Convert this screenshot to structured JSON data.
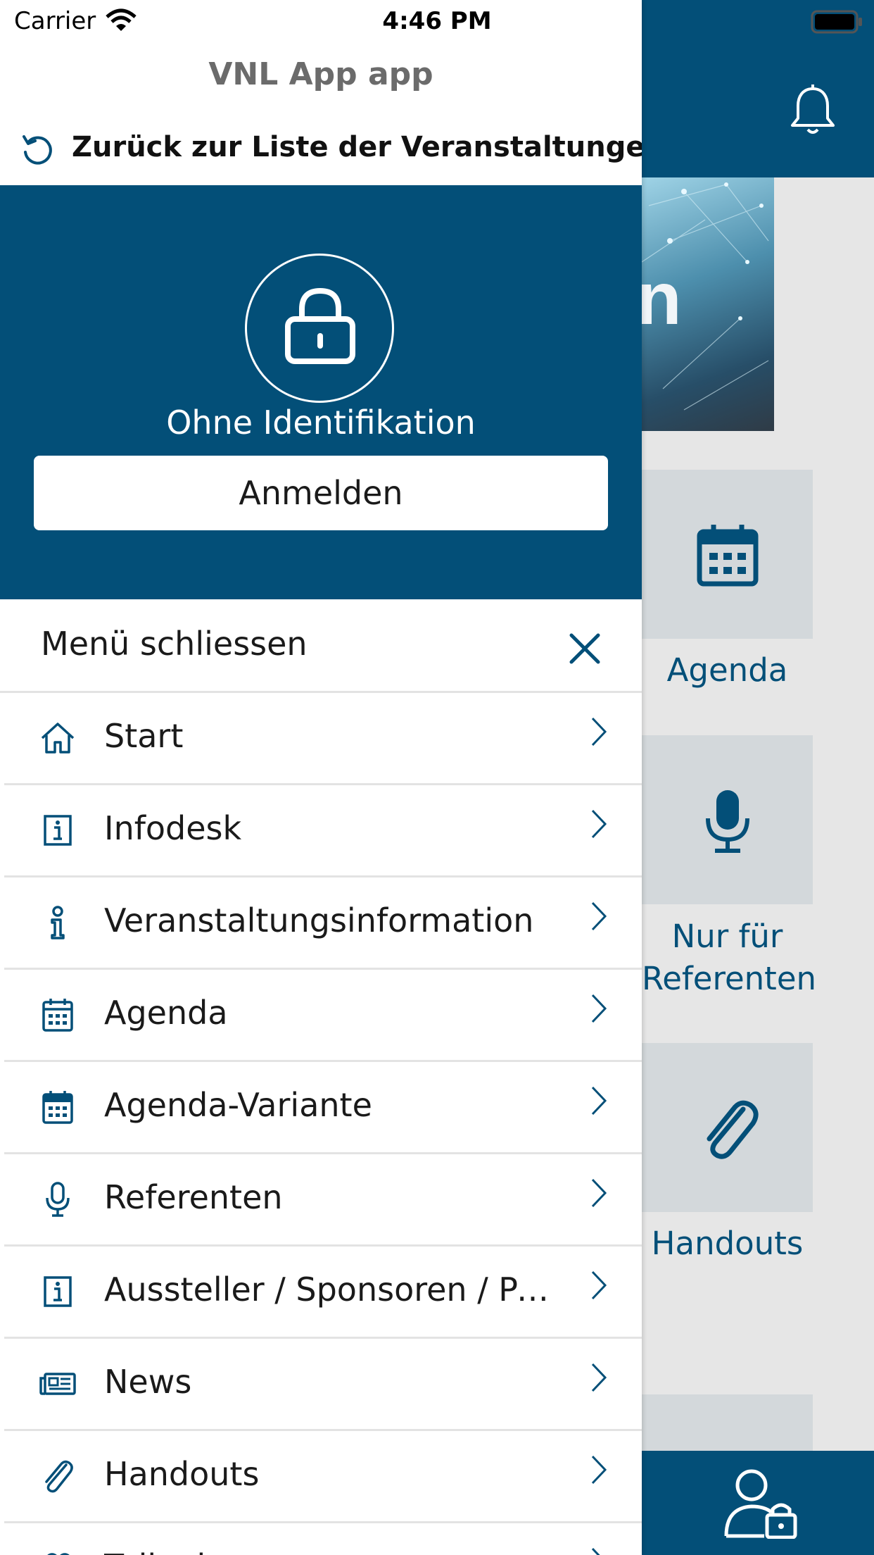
{
  "status_bar": {
    "carrier": "Carrier",
    "time": "4:46 PM"
  },
  "drawer": {
    "app_title": "VNL App app",
    "back_label": "Zurück zur Liste der Veranstaltungen",
    "profile": {
      "status": "Ohne Identifikation",
      "login_label": "Anmelden"
    },
    "close_label": "Menü schliessen",
    "menu": [
      {
        "label": "Start",
        "icon": "home-icon"
      },
      {
        "label": "Infodesk",
        "icon": "info-box-icon"
      },
      {
        "label": "Veranstaltungsinformation",
        "icon": "info-icon"
      },
      {
        "label": "Agenda",
        "icon": "calendar-outline-icon"
      },
      {
        "label": "Agenda-Variante",
        "icon": "calendar-filled-icon"
      },
      {
        "label": "Referenten",
        "icon": "microphone-icon"
      },
      {
        "label": "Aussteller / Sponsoren / Pa...",
        "icon": "info-box-icon"
      },
      {
        "label": "News",
        "icon": "newspaper-icon"
      },
      {
        "label": "Handouts",
        "icon": "paperclip-icon"
      },
      {
        "label": "Teilneh",
        "icon": "people-icon"
      }
    ]
  },
  "background": {
    "tiles": [
      {
        "label": "Agenda",
        "icon": "calendar-icon"
      },
      {
        "label_lines": [
          "Nur für",
          "Referenten"
        ],
        "icon": "microphone-icon"
      },
      {
        "label": "Handouts",
        "icon": "paperclip-icon"
      }
    ]
  },
  "colors": {
    "primary": "#034f78",
    "tile_bg": "#d3d8db",
    "background": "#e6e6e6"
  }
}
